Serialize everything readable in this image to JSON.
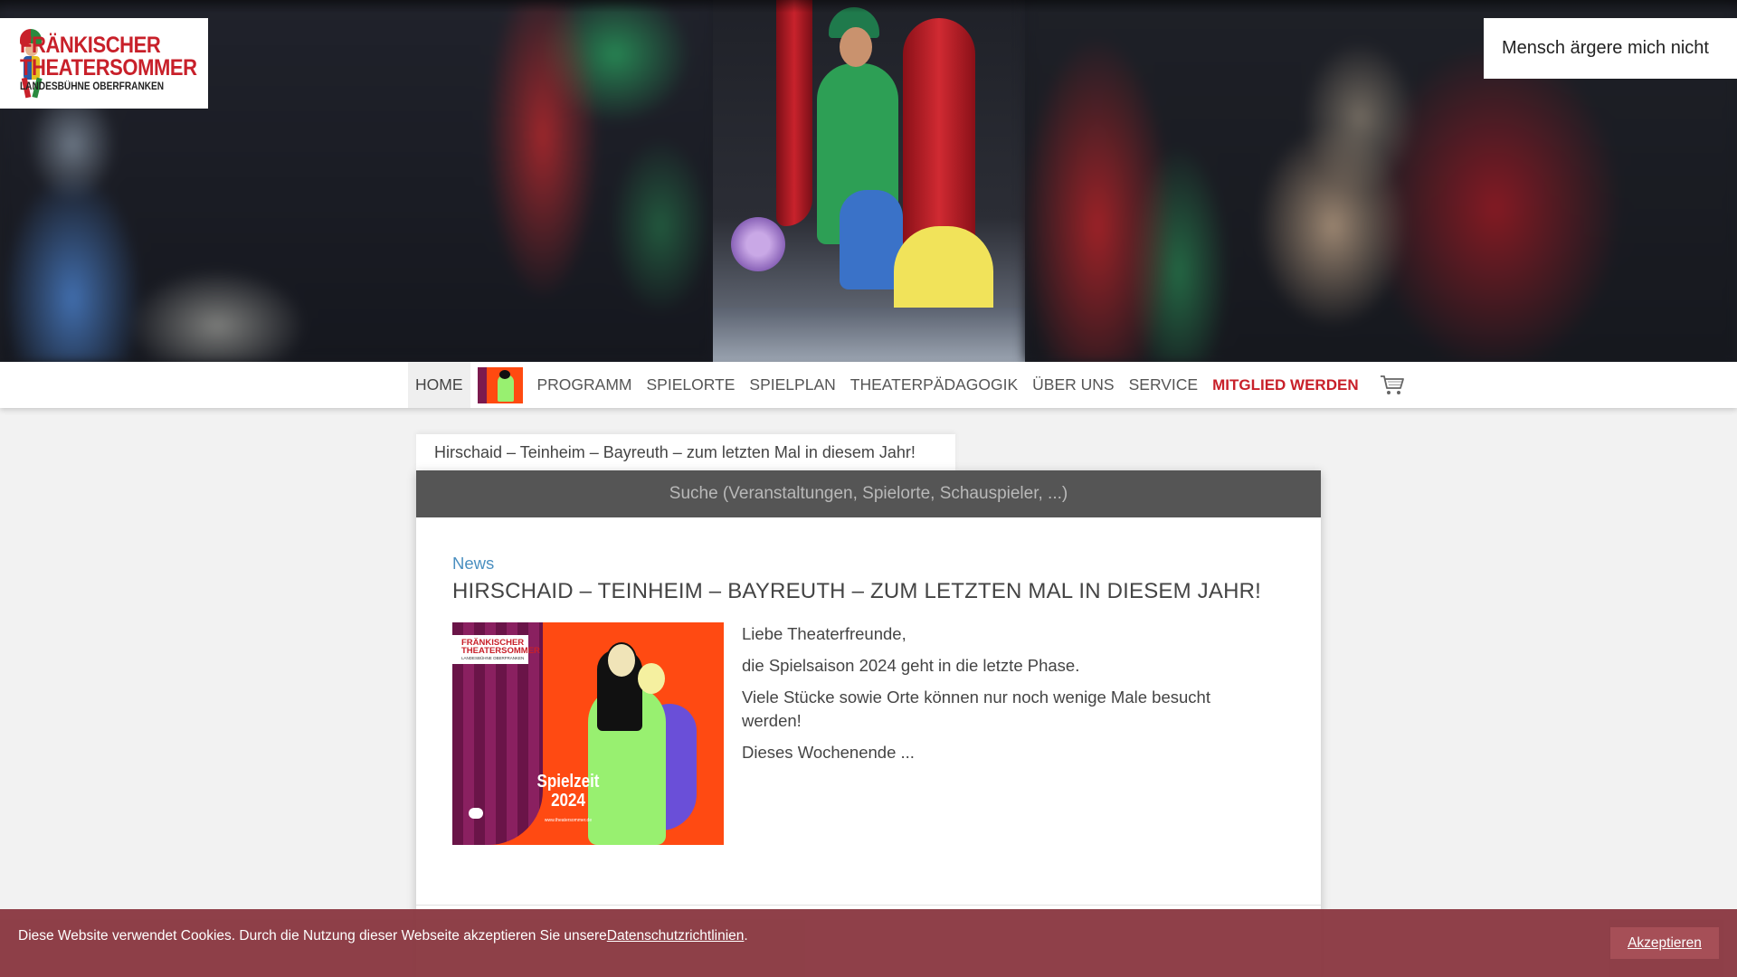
{
  "logo": {
    "line1": "FRÄNKISCHER",
    "line2": "THEATERSOMMER",
    "line3": "LANDESBÜHNE OBERFRANKEN"
  },
  "hero": {
    "caption": "Mensch ärgere mich nicht"
  },
  "nav": {
    "home": "HOME",
    "items": [
      "PROGRAMM",
      "SPIELORTE",
      "SPIELPLAN",
      "THEATERPÄDAGOGIK",
      "ÜBER UNS",
      "SERVICE"
    ],
    "member": "MITGLIED WERDEN",
    "cart_icon": "cart-icon"
  },
  "tab": {
    "label": "Hirschaid – Teinheim – Bayreuth – zum letzten Mal in diesem Jahr!"
  },
  "search": {
    "placeholder": "Suche (Veranstaltungen, Spielorte, Schauspieler, ...)"
  },
  "article": {
    "category": "News",
    "title": "HIRSCHAID – TEINHEIM – BAYREUTH – ZUM LETZTEN MAL IN DIESEM JAHR!",
    "image": {
      "logo_line1": "FRÄNKISCHER",
      "logo_line2": "THEATERSOMMER",
      "logo_line3": "LANDESBÜHNE OBERFRANKEN",
      "season_line1": "Spielzeit",
      "season_line2": "2024",
      "url": "www.theatersommer.de"
    },
    "paragraphs": [
      "Liebe Theaterfreunde,",
      "die Spielsaison 2024 geht in die letzte Phase.",
      "Viele Stücke sowie Orte können nur noch wenige Male besucht werden!",
      "Dieses Wochenende ..."
    ]
  },
  "cookie": {
    "text": "Diese Website verwendet Cookies. Durch die Nutzung dieser Webseite akzeptieren Sie unsere ",
    "link": "Datenschutzrichtlinien",
    "suffix": ".",
    "accept": "Akzeptieren"
  },
  "colors": {
    "brand_red": "#c8202a",
    "link_blue": "#4a8fc0",
    "search_bar": "#555555",
    "cookie_bg": "#8b3a43"
  }
}
